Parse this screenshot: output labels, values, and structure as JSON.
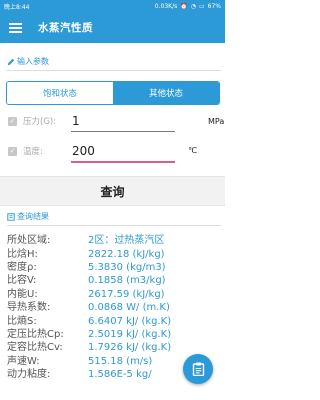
{
  "status": {
    "time": "晚上8:44",
    "speed": "0.03K/s",
    "battery": "67%"
  },
  "app": {
    "title": "水蒸汽性质"
  },
  "input_section": {
    "title": "输入参数",
    "tabs": [
      {
        "label": "饱和状态",
        "active": false
      },
      {
        "label": "其他状态",
        "active": true
      }
    ],
    "params": [
      {
        "label": "压力(G):",
        "value": "1",
        "unit": "MPa",
        "accent": "#7a7a7a"
      },
      {
        "label": "温度:",
        "value": "200",
        "unit": "℃",
        "accent": "#e05a8a"
      }
    ]
  },
  "query_button": {
    "label": "查询"
  },
  "result_section": {
    "title": "查询结果",
    "rows": [
      {
        "label": "所处区域:",
        "value": "2区：过热蒸汽区"
      },
      {
        "label": "比焓H:",
        "value": "2822.18 (kJ/kg)"
      },
      {
        "label": "密度ρ:",
        "value": "5.3830 (kg/m3)"
      },
      {
        "label": "比容V:",
        "value": "0.1858 (m3/kg)"
      },
      {
        "label": "内能U:",
        "value": "2617.59 (kJ/kg)"
      },
      {
        "label": "导热系数:",
        "value": "0.0868 W/ (m.K)"
      },
      {
        "label": "比熵S:",
        "value": "6.6407 kJ/ (kg.K)"
      },
      {
        "label": "定压比热Cp:",
        "value": "2.5019 kJ/ (kg.K)"
      },
      {
        "label": "定容比热Cv:",
        "value": "1.7926 kJ/ (kg.K)"
      },
      {
        "label": "声速W:",
        "value": "515.18 (m/s)"
      },
      {
        "label": "动力粘度:",
        "value": "1.586E-5 kg/"
      }
    ]
  },
  "colors": {
    "primary": "#2c9ad6",
    "temp_underline": "#e05a8a"
  },
  "icons": {
    "menu": "menu-icon",
    "edit": "pencil-icon",
    "list": "list-icon",
    "fab": "clipboard-icon"
  }
}
